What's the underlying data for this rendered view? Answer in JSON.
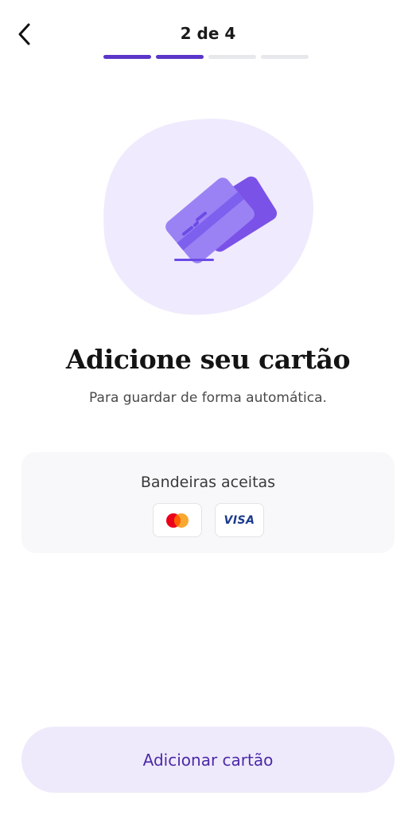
{
  "header": {
    "step_label": "2 de 4",
    "progress": {
      "current": 2,
      "total": 4
    },
    "back_icon": "chevron-left-icon"
  },
  "hero": {
    "icon": "credit-cards-illustration"
  },
  "content": {
    "title": "Adicione seu cartão",
    "subtitle": "Para guardar de forma automática."
  },
  "accepted_brands": {
    "title": "Bandeiras aceitas",
    "brands": [
      {
        "icon": "mastercard-icon"
      },
      {
        "label": "VISA",
        "icon": "visa-icon"
      }
    ]
  },
  "cta": {
    "label": "Adicionar cartão"
  },
  "colors": {
    "accent": "#5b36c9",
    "accent_light": "#efeafb",
    "hero_blob": "#efeafd",
    "card_front": "#9b82f4",
    "card_back": "#7a52e8"
  }
}
